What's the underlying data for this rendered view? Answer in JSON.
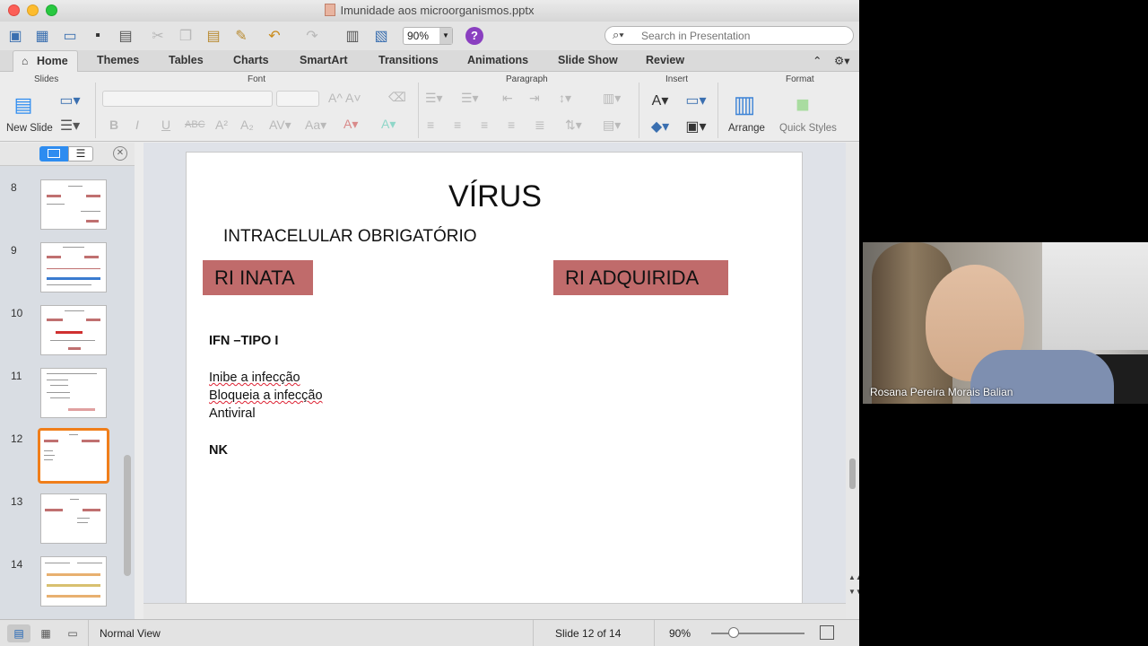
{
  "window": {
    "title": "Imunidade aos microorganismos.pptx"
  },
  "toolbar": {
    "zoom": "90%",
    "search_placeholder": "Search in Presentation"
  },
  "tabs": [
    "Home",
    "Themes",
    "Tables",
    "Charts",
    "SmartArt",
    "Transitions",
    "Animations",
    "Slide Show",
    "Review"
  ],
  "ribbon": {
    "groups": {
      "slides": "Slides",
      "font": "Font",
      "paragraph": "Paragraph",
      "insert": "Insert",
      "format": "Format"
    },
    "new_slide": "New Slide",
    "arrange": "Arrange",
    "quick_styles": "Quick Styles"
  },
  "thumbnails": {
    "numbers": [
      "8",
      "9",
      "10",
      "11",
      "12",
      "13",
      "14"
    ],
    "selected": "12"
  },
  "slide": {
    "title": "VÍRUS",
    "subtitle": "INTRACELULAR OBRIGATÓRIO",
    "box_left": "RI INATA",
    "box_right": "RI ADQUIRIDA",
    "line1": "IFN –TIPO I",
    "line2": "Inibe a infecção",
    "line3": "Bloqueia  a infecção",
    "line4": "Antiviral",
    "line5": "NK"
  },
  "status": {
    "view": "Normal View",
    "slide_pos": "Slide 12 of 14",
    "zoom": "90%"
  },
  "video": {
    "participant": "Rosana Pereira Morais Balian"
  },
  "colors": {
    "accent": "#2d8cf0",
    "selection": "#f07e1a",
    "slide_box": "#c06b6b"
  }
}
